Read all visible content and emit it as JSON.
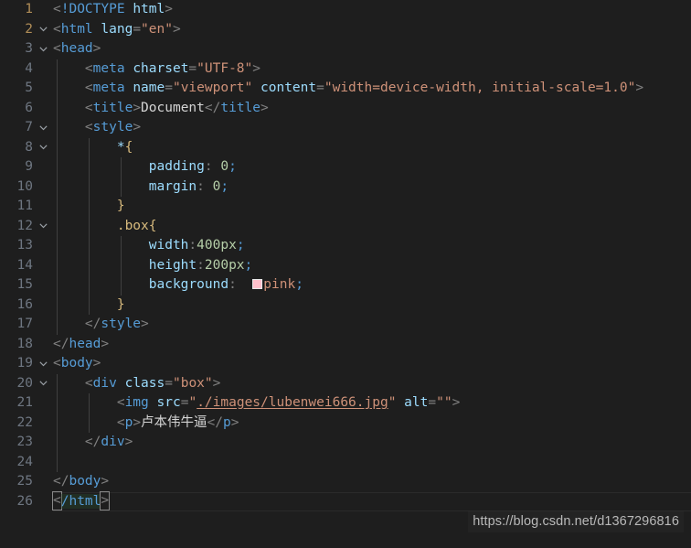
{
  "editor": {
    "background": "#1e1e1e",
    "font_size": "14.5px",
    "line_height": "21.5px",
    "language": "html",
    "total_lines": 26
  },
  "colors": {
    "background": "#1e1e1e",
    "gutter_text": "#6e7681",
    "gutter_active": "#b08d57",
    "punctuation": "#808080",
    "tag": "#569cd6",
    "attribute": "#9cdcfe",
    "string": "#ce9178",
    "text": "#d4d4d4",
    "css_selector": "#d7ba7d",
    "css_property": "#9cdcfe",
    "css_value": "#b5cea8",
    "css_keyword_value": "#ce9178",
    "indent_guide": "#404040",
    "swatch_pink": "#ffc0cb"
  },
  "lines": [
    {
      "num": "1",
      "fold": false,
      "guides": 0,
      "content": "<!DOCTYPE html>"
    },
    {
      "num": "2",
      "fold": true,
      "guides": 0,
      "content": "<html lang=\"en\">"
    },
    {
      "num": "3",
      "fold": true,
      "guides": 0,
      "content": "<head>"
    },
    {
      "num": "4",
      "fold": false,
      "guides": 1,
      "content": "    <meta charset=\"UTF-8\">"
    },
    {
      "num": "5",
      "fold": false,
      "guides": 1,
      "content": "    <meta name=\"viewport\" content=\"width=device-width, initial-scale=1.0\">"
    },
    {
      "num": "6",
      "fold": false,
      "guides": 1,
      "content": "    <title>Document</title>"
    },
    {
      "num": "7",
      "fold": true,
      "guides": 1,
      "content": "    <style>"
    },
    {
      "num": "8",
      "fold": true,
      "guides": 2,
      "content": "        *{"
    },
    {
      "num": "9",
      "fold": false,
      "guides": 3,
      "content": "            padding: 0;"
    },
    {
      "num": "10",
      "fold": false,
      "guides": 3,
      "content": "            margin: 0;"
    },
    {
      "num": "11",
      "fold": false,
      "guides": 2,
      "content": "        }"
    },
    {
      "num": "12",
      "fold": true,
      "guides": 2,
      "content": "        .box{"
    },
    {
      "num": "13",
      "fold": false,
      "guides": 3,
      "content": "            width:400px;"
    },
    {
      "num": "14",
      "fold": false,
      "guides": 3,
      "content": "            height:200px;"
    },
    {
      "num": "15",
      "fold": false,
      "guides": 3,
      "content": "            background:  pink;"
    },
    {
      "num": "16",
      "fold": false,
      "guides": 2,
      "content": "        }"
    },
    {
      "num": "17",
      "fold": false,
      "guides": 1,
      "content": "    </style>"
    },
    {
      "num": "18",
      "fold": false,
      "guides": 0,
      "content": "</head>"
    },
    {
      "num": "19",
      "fold": true,
      "guides": 0,
      "content": "<body>"
    },
    {
      "num": "20",
      "fold": true,
      "guides": 1,
      "content": "    <div class=\"box\">"
    },
    {
      "num": "21",
      "fold": false,
      "guides": 2,
      "content": "        <img src=\"./images/lubenwei666.jpg\" alt=\"\">"
    },
    {
      "num": "22",
      "fold": false,
      "guides": 2,
      "content": "        <p>卢本伟牛逼</p>"
    },
    {
      "num": "23",
      "fold": false,
      "guides": 1,
      "content": "    </div>"
    },
    {
      "num": "24",
      "fold": false,
      "guides": 1,
      "content": ""
    },
    {
      "num": "25",
      "fold": false,
      "guides": 0,
      "content": "</body>"
    },
    {
      "num": "26",
      "fold": false,
      "guides": 0,
      "content": "</html>"
    }
  ],
  "tokens": {
    "l1_lt": "<",
    "l1_doctype": "!DOCTYPE",
    "l1_sp": " ",
    "l1_html": "html",
    "l1_gt": ">",
    "l2_lt": "<",
    "l2_tag": "html",
    "l2_sp": " ",
    "l2_attr": "lang",
    "l2_eq": "=",
    "l2_val": "\"en\"",
    "l2_gt": ">",
    "l3_lt": "<",
    "l3_tag": "head",
    "l3_gt": ">",
    "l4_lt": "<",
    "l4_tag": "meta",
    "l4_sp": " ",
    "l4_attr": "charset",
    "l4_eq": "=",
    "l4_val": "\"UTF-8\"",
    "l4_gt": ">",
    "l5_lt": "<",
    "l5_tag": "meta",
    "l5_sp": " ",
    "l5_attr1": "name",
    "l5_eq1": "=",
    "l5_val1": "\"viewport\"",
    "l5_sp2": " ",
    "l5_attr2": "content",
    "l5_eq2": "=",
    "l5_val2": "\"width=device-width, initial-scale=1.0\"",
    "l5_gt": ">",
    "l6_lt": "<",
    "l6_tag": "title",
    "l6_gt": ">",
    "l6_text": "Document",
    "l6_lt2": "</",
    "l6_tag2": "title",
    "l6_gt2": ">",
    "l7_lt": "<",
    "l7_tag": "style",
    "l7_gt": ">",
    "l8_star": "*",
    "l8_brace": "{",
    "l9_prop": "padding",
    "l9_colon": ": ",
    "l9_val": "0",
    "l9_semi": ";",
    "l10_prop": "margin",
    "l10_colon": ": ",
    "l10_val": "0",
    "l10_semi": ";",
    "l11_brace": "}",
    "l12_sel": ".box",
    "l12_brace": "{",
    "l13_prop": "width",
    "l13_colon": ":",
    "l13_val": "400px",
    "l13_semi": ";",
    "l14_prop": "height",
    "l14_colon": ":",
    "l14_val": "200px",
    "l14_semi": ";",
    "l15_prop": "background",
    "l15_colon": ":  ",
    "l15_val": "pink",
    "l15_semi": ";",
    "l16_brace": "}",
    "l17_lt": "</",
    "l17_tag": "style",
    "l17_gt": ">",
    "l18_lt": "</",
    "l18_tag": "head",
    "l18_gt": ">",
    "l19_lt": "<",
    "l19_tag": "body",
    "l19_gt": ">",
    "l20_lt": "<",
    "l20_tag": "div",
    "l20_sp": " ",
    "l20_attr": "class",
    "l20_eq": "=",
    "l20_val": "\"box\"",
    "l20_gt": ">",
    "l21_lt": "<",
    "l21_tag": "img",
    "l21_sp": " ",
    "l21_attr1": "src",
    "l21_eq1": "=",
    "l21_q1": "\"",
    "l21_path": "./images/lubenwei666.jpg",
    "l21_q2": "\"",
    "l21_sp2": " ",
    "l21_attr2": "alt",
    "l21_eq2": "=",
    "l21_val2": "\"\"",
    "l21_gt": ">",
    "l22_lt": "<",
    "l22_tag": "p",
    "l22_gt": ">",
    "l22_text": "卢本伟牛逼",
    "l22_lt2": "</",
    "l22_tag2": "p",
    "l22_gt2": ">",
    "l23_lt": "</",
    "l23_tag": "div",
    "l23_gt": ">",
    "l25_lt": "</",
    "l25_tag": "body",
    "l25_gt": ">",
    "l26_lt": "<",
    "l26_slashtag": "/html",
    "l26_gt": ">"
  },
  "watermark": {
    "text": "https://blog.csdn.net/d1367296816"
  },
  "icons": {
    "fold_chevron": "chevron-down-icon"
  }
}
